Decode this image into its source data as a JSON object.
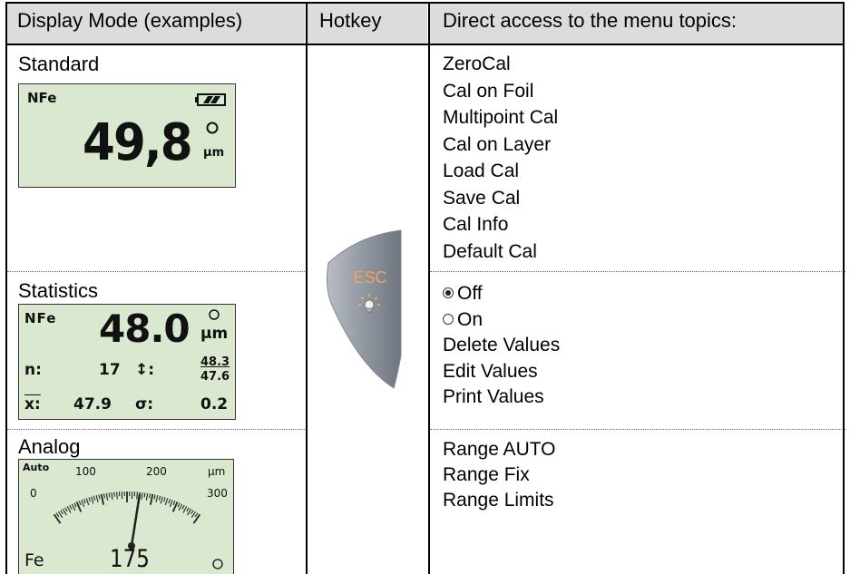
{
  "header": {
    "col1": "Display Mode (examples)",
    "col2": "Hotkey",
    "col3": "Direct access to the menu topics:"
  },
  "rows": [
    {
      "title": "Standard",
      "lcd": {
        "material": "NFe",
        "value": "49,8",
        "unit": "µm"
      },
      "menu": [
        "ZeroCal",
        "Cal on Foil",
        "Multipoint Cal",
        "Cal on Layer",
        "Load Cal",
        "Save Cal",
        "Cal Info",
        "Default Cal"
      ]
    },
    {
      "title": "Statistics",
      "lcd": {
        "material": "NFe",
        "value": "48.0",
        "unit": "µm",
        "n_label": "n:",
        "n_value": "17",
        "range_symbol": "↕:",
        "max": "48.3",
        "min": "47.6",
        "mean_label": "x:",
        "mean_value": "47.9",
        "sigma_label": "σ:",
        "sigma_value": "0.2"
      },
      "menu": [
        {
          "label": "Off",
          "radio": "selected"
        },
        {
          "label": "On",
          "radio": "unselected"
        },
        {
          "label": "Delete Values"
        },
        {
          "label": "Edit Values"
        },
        {
          "label": "Print Values"
        }
      ]
    },
    {
      "title": "Analog",
      "lcd": {
        "mode": "Auto",
        "scale_labels": [
          "0",
          "100",
          "200",
          "300"
        ],
        "unit": "µm",
        "material": "Fe",
        "value": "175",
        "needle_value": 175,
        "scale_min": 0,
        "scale_max": 300
      },
      "menu": [
        "Range AUTO",
        "Range Fix",
        "Range Limits"
      ]
    }
  ],
  "hotkey": {
    "label": "ESC",
    "icon": "light-bulb-icon",
    "color": "#f0a060"
  }
}
